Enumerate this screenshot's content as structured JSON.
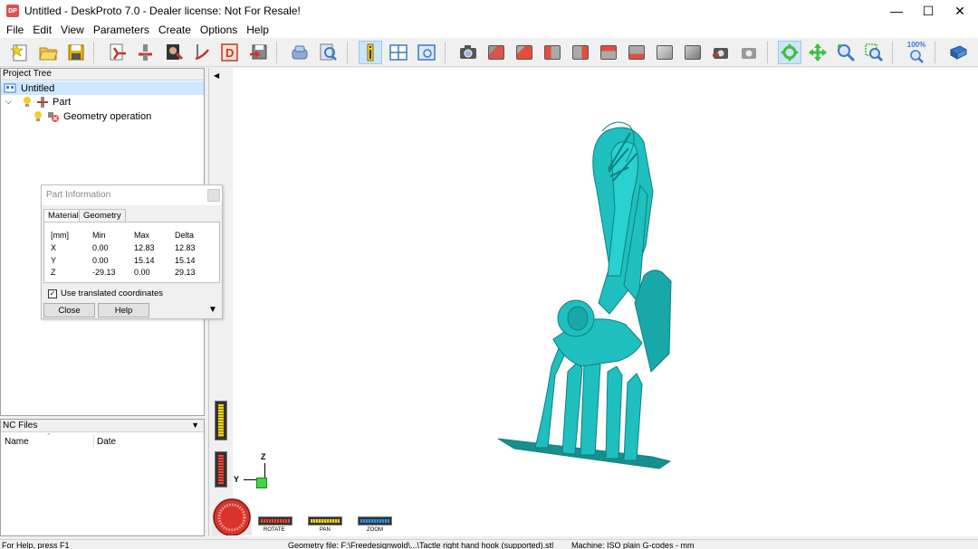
{
  "window": {
    "app_icon": "DP",
    "title": "Untitled - DeskProto 7.0 - Dealer license: Not For Resale!",
    "minimize": "—",
    "maximize": "☐",
    "close": "✕"
  },
  "menu": [
    "File",
    "Edit",
    "View",
    "Parameters",
    "Create",
    "Options",
    "Help"
  ],
  "toolbar": {
    "zoom_percent": "100%",
    "icons": [
      "new-file-icon",
      "open-folder-icon",
      "save-icon",
      "import-geometry-icon",
      "part-icon",
      "bitmap-icon",
      "vector-icon",
      "d-icon",
      "save-as-icon",
      "transfer-icon",
      "search-doc-icon",
      "info-icon",
      "layout-icon",
      "view-window-icon",
      "camera-icon",
      "cube-front-icon",
      "cube-back-icon",
      "cube-left-icon",
      "cube-right-icon",
      "cube-top-icon",
      "cube-bottom-icon",
      "cube-iso-icon",
      "cube-iso2-icon",
      "render-icon",
      "refresh-view-icon",
      "rotate-icon",
      "pan-icon",
      "zoom-in-icon",
      "zoom-window-icon",
      "zoom-100-icon",
      "book-icon"
    ]
  },
  "project_tree": {
    "header": "Project Tree",
    "root": "Untitled",
    "part": "Part",
    "operation": "Geometry operation"
  },
  "nc_files": {
    "header": "NC Files",
    "col_name": "Name",
    "col_date": "Date"
  },
  "part_info": {
    "title": "Part Information",
    "tabs": [
      "Material",
      "Geometry"
    ],
    "headers": [
      "[mm]",
      "Min",
      "Max",
      "Delta"
    ],
    "rows": [
      {
        "axis": "X",
        "min": "0.00",
        "max": "12.83",
        "delta": "12.83"
      },
      {
        "axis": "Y",
        "min": "0.00",
        "max": "15.14",
        "delta": "15.14"
      },
      {
        "axis": "Z",
        "min": "-29.13",
        "max": "0.00",
        "delta": "29.13"
      }
    ],
    "checkbox_label": "Use translated coordinates",
    "checkbox_checked": true,
    "close_label": "Close",
    "help_label": "Help"
  },
  "viewport": {
    "axis_z": "Z",
    "axis_y": "Y",
    "rotate_label": "ROTATE",
    "pan_label": "PAN",
    "zoom_label": "ZOOM",
    "model_color": "#1fbfbf"
  },
  "status": {
    "help": "For Help, press F1",
    "geometry": "Geometry file: F:\\Freedesignwold\\...\\Tactle right hand hook (supported).stl",
    "machine": "Machine: ISO plain G-codes - mm"
  }
}
